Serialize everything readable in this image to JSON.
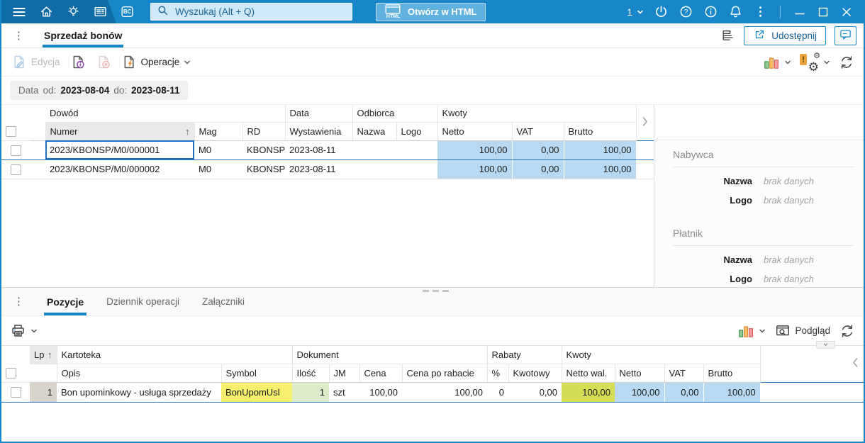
{
  "window": {
    "workspace_number": "1"
  },
  "topbar": {
    "search": {
      "placeholder": "Wyszukaj (Alt + Q)"
    },
    "open_html_button": "Otwórz w HTML",
    "bc_icon_label": "BC",
    "html_icon_label": "HTML"
  },
  "tabbar": {
    "active_tab": "Sprzedaż bonów",
    "share_button": "Udostępnij"
  },
  "toolbar": {
    "edit_button": "Edycja",
    "operations_button": "Operacje"
  },
  "filterbar": {
    "field_label": "Data",
    "from_label": "od:",
    "from_value": "2023-08-04",
    "to_label": "do:",
    "to_value": "2023-08-11"
  },
  "main_table": {
    "groups": {
      "dowod": "Dowód",
      "data": "Data",
      "odbiorca": "Odbiorca",
      "kwoty": "Kwoty"
    },
    "columns": {
      "numer": "Numer",
      "mag": "Mag",
      "rd": "RD",
      "wystawienia": "Wystawienia",
      "nazwa": "Nazwa",
      "logo": "Logo",
      "netto": "Netto",
      "vat": "VAT",
      "brutto": "Brutto"
    },
    "sort_indicator": "↑",
    "rows": [
      {
        "numer": "2023/KBONSP/M0/000001",
        "mag": "M0",
        "rd": "KBONSP",
        "wystawienia": "2023-08-11",
        "nazwa": "",
        "logo": "",
        "netto": "100,00",
        "vat": "0,00",
        "brutto": "100,00"
      },
      {
        "numer": "2023/KBONSP/M0/000002",
        "mag": "M0",
        "rd": "KBONSP",
        "wystawienia": "2023-08-11",
        "nazwa": "",
        "logo": "",
        "netto": "100,00",
        "vat": "0,00",
        "brutto": "100,00"
      }
    ]
  },
  "details_panel": {
    "nabywca": {
      "title": "Nabywca",
      "fields": [
        {
          "label": "Nazwa",
          "value": "brak danych"
        },
        {
          "label": "Logo",
          "value": "brak danych"
        }
      ]
    },
    "platnik": {
      "title": "Płatnik",
      "fields": [
        {
          "label": "Nazwa",
          "value": "brak danych"
        },
        {
          "label": "Logo",
          "value": "brak danych"
        }
      ]
    }
  },
  "subtabs": {
    "tabs": [
      "Pozycje",
      "Dziennik operacji",
      "Załączniki"
    ],
    "active": "Pozycje"
  },
  "subtoolbar": {
    "preview_button": "Podgląd"
  },
  "items_table": {
    "groups": {
      "lp": "Lp",
      "kartoteka": "Kartoteka",
      "dokument": "Dokument",
      "rabaty": "Rabaty",
      "kwoty": "Kwoty"
    },
    "columns": {
      "opis": "Opis",
      "symbol": "Symbol",
      "ilosc": "Ilość",
      "jm": "JM",
      "cena": "Cena",
      "cena_po_rabacie": "Cena po rabacie",
      "procent": "%",
      "kwotowy": "Kwotowy",
      "netto_wal": "Netto wal.",
      "netto": "Netto",
      "vat": "VAT",
      "brutto": "Brutto"
    },
    "sort_indicator": "↑",
    "rows": [
      {
        "lp": "1",
        "opis": "Bon upominkowy - usługa sprzedaży",
        "symbol": "BonUpomUsl",
        "ilosc": "1",
        "jm": "szt",
        "cena": "100,00",
        "cena_po_rabacie": "100,00",
        "procent": "0",
        "kwotowy": "0,00",
        "netto_wal": "100,00",
        "netto": "100,00",
        "vat": "0,00",
        "brutto": "100,00"
      }
    ]
  },
  "colors": {
    "accent_blue": "#1787c9",
    "topbar_dark_blue": "#0f6ca7",
    "selected_row_border": "#2b77c0",
    "amount_cell_blue": "#b9d9f3",
    "symbol_cell_yellow": "#f5ef6d",
    "quantity_cell_green": "#dcecca",
    "netto_wal_cell_olive": "#d7dc55",
    "lp_cell_gray": "#d8d4cc"
  }
}
